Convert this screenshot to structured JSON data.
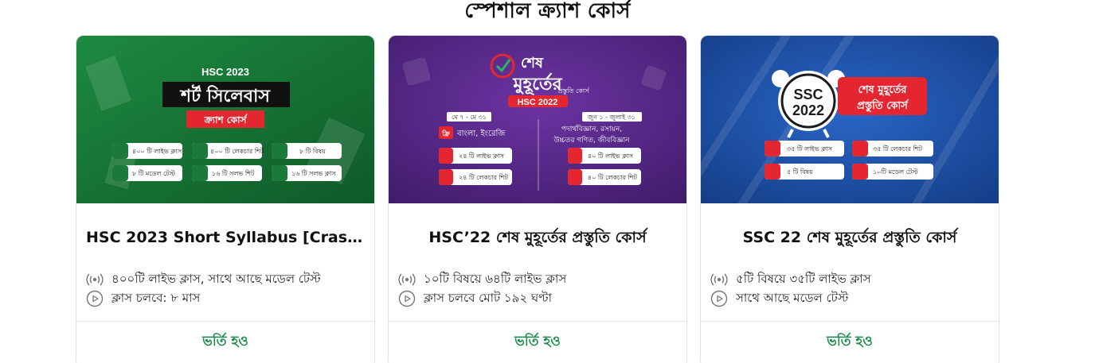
{
  "section_title": "স্পেশাল ক্র্যাশ কোর্স",
  "colors": {
    "accent_green": "#1f8a4c",
    "banner_green": "#1b7a3a",
    "banner_purple": "#5a2a8a",
    "banner_blue": "#1b4fa3",
    "badge_red": "#e3262f"
  },
  "cards": [
    {
      "title": "HSC 2023 Short Syllabus [Crash ...",
      "features": [
        {
          "icon": "live-signal-icon",
          "text": "৪০০টি লাইভ ক্লাস, সাথে আছে মডেল টেস্ট"
        },
        {
          "icon": "play-circle-icon",
          "text": "ক্লাস চলবে: ৮ মাস"
        }
      ],
      "button": "ভর্তি হও",
      "banner": {
        "year": "HSC 2023",
        "headline": "শর্ট সিলেবাস",
        "ribbon": "ক্র্যাশ কোর্স",
        "chips": [
          "৪০০ টি লাইভ ক্লাস",
          "৪০০ টি লেকচার শিট",
          "৮ টি বিষয়",
          "৮ টি মডেল টেস্ট",
          "১৬ টি সলভ শিট",
          "১৬ টি সলভ ক্লাস"
        ]
      }
    },
    {
      "title": "HSC’22 শেষ মুহূর্তের প্রস্তুতি কোর্স",
      "features": [
        {
          "icon": "live-signal-icon",
          "text": "১০টি বিষয়ে ৬৪টি লাইভ ক্লাস"
        },
        {
          "icon": "play-circle-icon",
          "text": "ক্লাস চলবে মোট ১৯২ ঘণ্টা"
        }
      ],
      "button": "ভর্তি হও",
      "banner": {
        "headline_1": "শেষ",
        "headline_2": "মুহূর্তের",
        "subline": "প্রস্তুতি কোর্স",
        "year": "HSC 2022",
        "left_date": "মে ৭ - মে ৩১",
        "left_free": "ফ্রি",
        "left_subjects": "বাংলা, ইংরেজি",
        "left_chips": [
          "২৪ টি লাইভ ক্লাস",
          "২৪ টি লেকচার শিট"
        ],
        "right_date": "জুন ১ - জুলাই ৩১",
        "right_subjects_1": "পদার্থবিজ্ঞান, রসায়ন,",
        "right_subjects_2": "উচ্চতর গণিত, জীববিজ্ঞান",
        "right_chips": [
          "৪০ টি লাইভ ক্লাস",
          "৪০ টি লেকচার শিট"
        ]
      }
    },
    {
      "title": "SSC 22 শেষ মুহূর্তের প্রস্তুতি কোর্স",
      "features": [
        {
          "icon": "live-signal-icon",
          "text": "৫টি বিষয়ে ৩৫টি লাইভ ক্লাস"
        },
        {
          "icon": "play-circle-icon",
          "text": "সাথে আছে মডেল টেস্ট"
        }
      ],
      "button": "ভর্তি হও",
      "banner": {
        "clock_1": "SSC",
        "clock_2": "2022",
        "badge_1": "শেষ মুহূর্তের",
        "badge_2": "প্রস্তুতি কোর্স",
        "chips": [
          "৩৫ টি লাইভ ক্লাস",
          "৩৫ টি লেকচার শিট",
          "৫ টি বিষয়",
          "১০টি মডেল টেস্ট"
        ]
      }
    }
  ]
}
